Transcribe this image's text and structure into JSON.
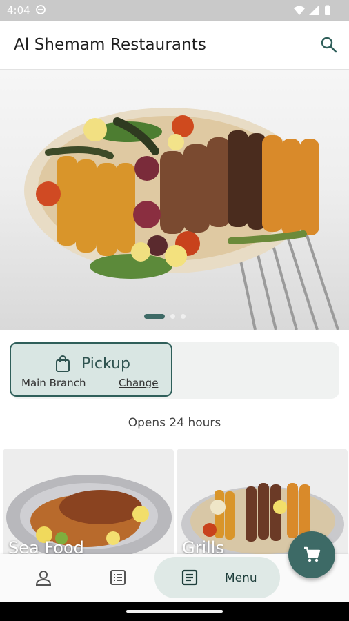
{
  "status_bar": {
    "time": "4:04",
    "icons": [
      "vpn-icon",
      "wifi-icon",
      "signal-icon",
      "battery-icon"
    ]
  },
  "app_bar": {
    "title": "Al Shemam Restaurants",
    "action_icon": "search-icon"
  },
  "hero": {
    "image": "mixed-grill-platter",
    "page_count": 3,
    "active_page": 1
  },
  "order_type": {
    "mode": "Pickup",
    "branch": "Main Branch",
    "change_label": "Change"
  },
  "hours_text": "Opens 24 hours",
  "categories": [
    {
      "label": "Sea Food",
      "image": "grilled-fish-platter"
    },
    {
      "label": "Grills",
      "image": "mixed-grill-platter"
    }
  ],
  "bottom_nav": {
    "items": [
      {
        "icon": "person-icon"
      },
      {
        "icon": "orders-list-icon"
      },
      {
        "icon": "menu-icon",
        "label": "Menu",
        "selected": true
      }
    ]
  },
  "fab": {
    "icon": "cart-icon"
  },
  "colors": {
    "primary": "#3d6a66",
    "pickup_bg": "#d9e6e3",
    "nav_selected": "#dfe9e6",
    "status_bar": "#c9c9c9"
  }
}
